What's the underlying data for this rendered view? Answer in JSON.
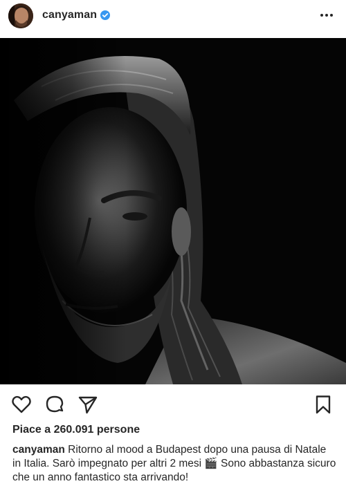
{
  "post": {
    "username": "canyaman",
    "verified": true,
    "more_icon": "more-horizontal-icon",
    "image_description_icon": "portrait-photo",
    "likes_text": "Piace a 260.091 persone",
    "caption_user": "canyaman",
    "caption_text": " Ritorno al mood a Budapest dopo una pausa di Natale in Italia. Sarò impegnato per altri 2 mesi 🎬 Sono abbastanza sicuro che un anno fantastico sta arrivando!"
  },
  "actions": {
    "like_icon": "heart-icon",
    "comment_icon": "comment-icon",
    "share_icon": "share-icon",
    "save_icon": "bookmark-icon"
  },
  "colors": {
    "verified_blue": "#3897f0",
    "text": "#262626",
    "photo_bg": "#050505"
  }
}
